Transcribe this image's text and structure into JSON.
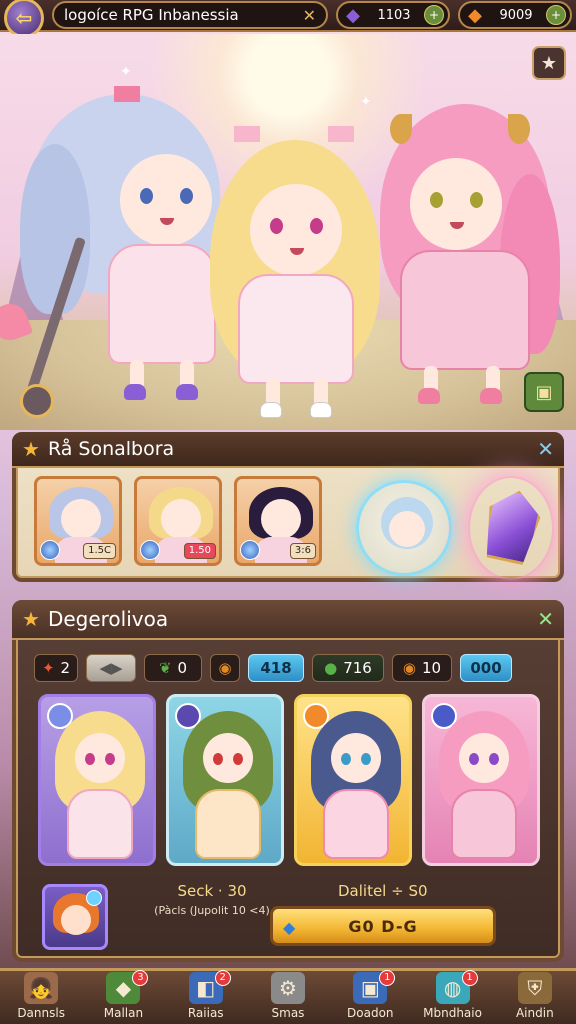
{
  "topbar": {
    "title": "logoíce RPG Inbanessia",
    "close_label": "✕",
    "currency_gems": "1103",
    "currency_gold": "9009",
    "plus_label": "+"
  },
  "recruited_panel": {
    "title": "Rå Sonalbora",
    "close_label": "✕",
    "cards": [
      {
        "tag": "1.5C",
        "hair": "#b9c6e8",
        "frame": "#c87a3a"
      },
      {
        "tag": "1.50",
        "hair": "#f4d98a",
        "frame": "#c87a3a"
      },
      {
        "tag": "3:6",
        "hair": "#2a1c3c",
        "frame": "#c87a3a"
      }
    ]
  },
  "recruit_panel": {
    "title": "Degerolivoa",
    "close_label": "✕",
    "stats": [
      {
        "icon": "✦",
        "value": "2",
        "style": "dark",
        "icon_color": "#e35a3a"
      },
      {
        "icon": "◀▶",
        "value": "",
        "style": "grey",
        "icon_color": "#555"
      },
      {
        "icon": "❦",
        "value": "0",
        "style": "dark",
        "icon_color": "#58b24a"
      },
      {
        "icon": "◉",
        "value": "",
        "style": "dark",
        "icon_color": "#e08a2a"
      },
      {
        "icon": "",
        "value": "418",
        "style": "blue",
        "icon_color": "#fff"
      },
      {
        "icon": "●",
        "value": "716",
        "style": "green",
        "icon_color": "#58b24a"
      },
      {
        "icon": "◉",
        "value": "10",
        "style": "dark",
        "icon_color": "#e08a2a"
      },
      {
        "icon": "",
        "value": "000",
        "style": "blue",
        "icon_color": "#fff"
      }
    ],
    "pack_title": "Seck · 30",
    "pack_subtitle": "(Pàcls (Jupolit 10 <4)",
    "dalitel_label": "Dalitel ÷ S0",
    "go_button_label": "G0 D-G"
  },
  "bottom_nav": [
    {
      "label": "Dannsls",
      "icon": "👧",
      "badge": ""
    },
    {
      "label": "Mallan",
      "icon": "◆",
      "badge": "3"
    },
    {
      "label": "Raiias",
      "icon": "◧",
      "badge": "2"
    },
    {
      "label": "Smas",
      "icon": "⚙",
      "badge": ""
    },
    {
      "label": "Doadon",
      "icon": "▣",
      "badge": "1"
    },
    {
      "label": "Mbndhaio",
      "icon": "◍",
      "badge": "1"
    },
    {
      "label": "Aindin",
      "icon": "⛨",
      "badge": ""
    }
  ],
  "colors": {
    "accent_gold": "#e6b65a",
    "panel_brown": "#6d4a30",
    "button_yellow": "#f2b532",
    "badge_red": "#e33b3b"
  }
}
